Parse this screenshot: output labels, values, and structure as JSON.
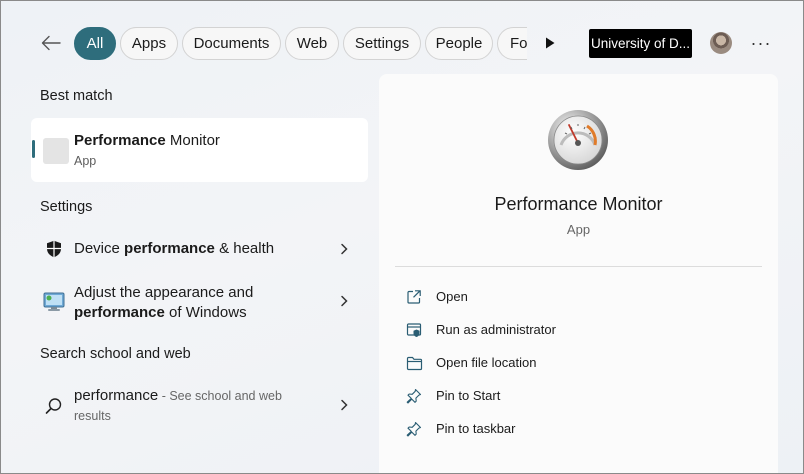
{
  "filters": {
    "chips": [
      {
        "label": "All",
        "active": true
      },
      {
        "label": "Apps"
      },
      {
        "label": "Documents"
      },
      {
        "label": "Web"
      },
      {
        "label": "Settings"
      },
      {
        "label": "People"
      },
      {
        "label": "Fo"
      }
    ],
    "org_label": "University of D...",
    "more_label": "···"
  },
  "best_match": {
    "heading": "Best match",
    "title_bold": "Performance",
    "title_rest": " Monitor",
    "subtitle": "App"
  },
  "settings": {
    "heading": "Settings",
    "items": [
      {
        "pre": "Device ",
        "bold": "performance",
        "post": " & health"
      },
      {
        "line1": "Adjust the appearance and",
        "bold": "performance",
        "post": " of Windows"
      }
    ]
  },
  "web": {
    "heading": "Search school and web",
    "query": "performance",
    "hint_line1": " - See school and web",
    "hint_line2": "results"
  },
  "preview": {
    "title": "Performance Monitor",
    "subtitle": "App",
    "actions": [
      {
        "label": "Open",
        "icon": "open-external-icon"
      },
      {
        "label": "Run as administrator",
        "icon": "shield-admin-icon"
      },
      {
        "label": "Open file location",
        "icon": "folder-icon"
      },
      {
        "label": "Pin to Start",
        "icon": "pin-icon"
      },
      {
        "label": "Pin to taskbar",
        "icon": "pin-icon"
      }
    ]
  },
  "colors": {
    "accent": "#2e6d7c",
    "org_bg": "#000000"
  }
}
